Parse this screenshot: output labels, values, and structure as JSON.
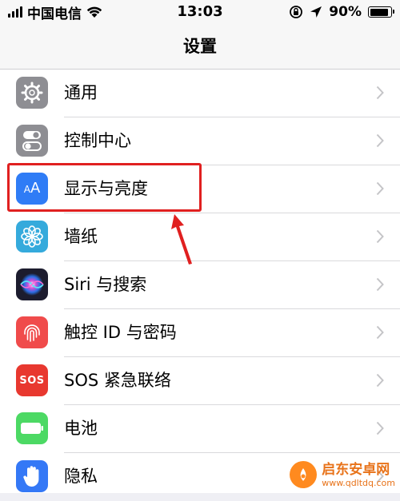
{
  "status_bar": {
    "carrier": "中国电信",
    "time": "13:03",
    "battery_percent": "90%",
    "battery_level": 0.9
  },
  "nav": {
    "title": "设置"
  },
  "settings": [
    {
      "label": "通用",
      "icon": "gear-icon",
      "color": "#8e8e93"
    },
    {
      "label": "控制中心",
      "icon": "toggles-icon",
      "color": "#8e8e93"
    },
    {
      "label": "显示与亮度",
      "icon": "text-size-icon",
      "color": "#2f7cf6",
      "icon_text": "AA"
    },
    {
      "label": "墙纸",
      "icon": "flower-icon",
      "color": "#35aadc"
    },
    {
      "label": "Siri 与搜索",
      "icon": "siri-icon",
      "color": "#1c1c2e"
    },
    {
      "label": "触控 ID 与密码",
      "icon": "fingerprint-icon",
      "color": "#f04b4b"
    },
    {
      "label": "SOS 紧急联络",
      "icon": "sos-icon",
      "color": "#e8382f",
      "icon_text": "SOS"
    },
    {
      "label": "电池",
      "icon": "battery-icon",
      "color": "#4cd964"
    },
    {
      "label": "隐私",
      "icon": "hand-icon",
      "color": "#3478f6"
    }
  ],
  "watermark": {
    "title": "启东安卓网",
    "url": "www.qdltdq.com"
  }
}
